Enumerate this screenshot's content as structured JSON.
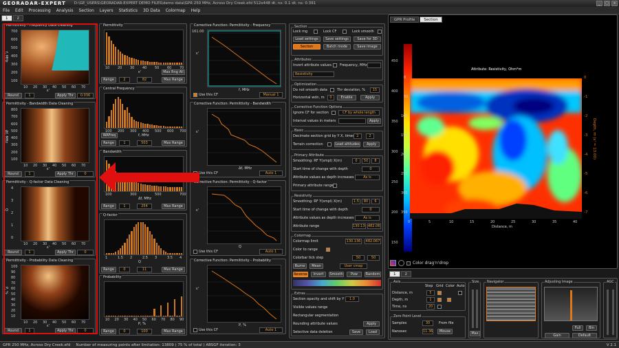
{
  "titlebar": {
    "logo": "GEORADAR-EXPERT",
    "text": "D:\\GE_USERS\\GEORADAR-EXPERT DEMO FILES\\demo data\\GPR 250 MHz, Across Dry Creek.efd    512x448    dt, ns: 0.1    dt, ns: 0.391"
  },
  "menu": [
    "File",
    "Edit",
    "Processing",
    "Analysis",
    "Section",
    "Layers",
    "Statistics",
    "3D Data",
    "Colormap",
    "Help"
  ],
  "tabs": [
    "1",
    "2"
  ],
  "left": {
    "panels": [
      {
        "title": "Permittivity - Frequency Data Cleaning",
        "ylabel": "f, MHz",
        "xlabel": "ε'",
        "yticks": [
          "700",
          "600",
          "500",
          "400",
          "300",
          "200",
          "100"
        ],
        "xticks": [
          "10",
          "20",
          "30",
          "40",
          "50",
          "60",
          "70"
        ],
        "round": "Round",
        "field1": "1",
        "applythr": "Apply Thr",
        "field2": "0.036"
      },
      {
        "title": "Permittivity - Bandwidth Data Cleaning",
        "ylabel": "Δf, MHz",
        "xlabel": "ε'",
        "yticks": [
          "800",
          "700",
          "600",
          "500",
          "400",
          "300",
          "200",
          "100"
        ],
        "xticks": [
          "10",
          "20",
          "30",
          "40",
          "50",
          "60",
          "70"
        ],
        "round": "Round",
        "field1": "1",
        "applythr": "Apply Thr",
        "field2": "0"
      },
      {
        "title": "Permittivity - Q-factor Data Cleaning",
        "ylabel": "Q",
        "xlabel": "ε'",
        "yticks": [
          "4",
          "3",
          "2",
          "1",
          "0"
        ],
        "xticks": [
          "10",
          "20",
          "30",
          "40",
          "50",
          "60",
          "70"
        ],
        "round": "Round",
        "field1": "1",
        "applythr": "Apply Thr",
        "field2": "0"
      },
      {
        "title": "Permittivity - Probability Data Cleaning",
        "ylabel": "P, %",
        "xlabel": "ε'",
        "yticks": [
          "100",
          "90",
          "80",
          "70",
          "60",
          "50",
          "40",
          "30",
          "20",
          "10"
        ],
        "xticks": [
          "10",
          "20",
          "30",
          "40",
          "50",
          "60",
          "70"
        ],
        "round": "Round",
        "field1": "1",
        "applythr": "Apply Thr",
        "field2": "0"
      }
    ]
  },
  "hist": {
    "panels": [
      {
        "title": "Permittivity",
        "xlabel": "ε'",
        "xticks": [
          "10",
          "20",
          "30",
          "40",
          "50",
          "60",
          "70"
        ],
        "range": "Range",
        "f1": "2",
        "f2": "82",
        "maxrange": "Max Rng All",
        "maxrange2": "Max Range"
      },
      {
        "title": "Central Frequency",
        "xlabel": "f, MHz",
        "xticks": [
          "100",
          "200",
          "300",
          "400",
          "500",
          "600",
          "700"
        ],
        "extra": "WAFreq",
        "range": "Range",
        "f1": "1",
        "f2": "503",
        "maxrange": "Max Range"
      },
      {
        "title": "Bandwidth",
        "xlabel": "Δf, MHz",
        "xticks": [
          "100",
          "300",
          "500",
          "700"
        ],
        "range": "Range",
        "f1": "1",
        "f2": "254",
        "maxrange": "Max Range"
      },
      {
        "title": "Q-factor",
        "xlabel": "Q",
        "xticks": [
          "1",
          "1.5",
          "2",
          "2.5",
          "3",
          "3.5",
          "4"
        ],
        "range": "Range",
        "f1": "0",
        "f2": "11",
        "maxrange": "Max Range"
      },
      {
        "title": "Probability",
        "xlabel": "P, %",
        "xticks": [
          "10",
          "20",
          "30",
          "40",
          "50",
          "60",
          "70",
          "80",
          "90"
        ],
        "range": "Range",
        "f1": "0",
        "f2": "100",
        "maxrange": "Max Range"
      }
    ]
  },
  "corr": {
    "panels": [
      {
        "title": "Corrective Function: Permittivity - Frequency",
        "xlabel": "f, MHz",
        "ylabel": "ε'",
        "useCF": "Use this CF",
        "mode": "Manual 1",
        "topval": "161.00"
      },
      {
        "title": "Corrective Function: Permittivity - Bandwidth",
        "xlabel": "Δf, MHz",
        "ylabel": "ε'",
        "useCF": "Use this CF",
        "mode": "Auto 1"
      },
      {
        "title": "Corrective Function: Permittivity - Q-factor",
        "xlabel": "Q",
        "ylabel": "ε'",
        "useCF": "Use this CF",
        "mode": "Auto 1"
      },
      {
        "title": "Corrective Function: Permittivity - Probability",
        "xlabel": "P, %",
        "ylabel": "ε'",
        "useCF": "Use this CF",
        "mode": "Auto 1"
      }
    ]
  },
  "controls": {
    "section": {
      "title": "Section",
      "lockmg": "Lock mg",
      "lockcf": "Lock CF",
      "locksmooth": "Lock smooth",
      "loadsettings": "Load settings",
      "savesettings": "Save settings",
      "save3d": "Save for 3D",
      "section": "Section",
      "batch": "Batch mode",
      "saveimage": "Save image"
    },
    "attributes": {
      "title": "Attributes",
      "invert": "Invert attribute values",
      "freq": "Frequency, MHz",
      "selected": "Resistivity"
    },
    "optimization": {
      "title": "Optimization",
      "nosmooth": "Do not smooth data",
      "thr": "Thr deviation, %",
      "thrval": "15",
      "horiz": "Horizontal wdn, m",
      "horizval": "0",
      "enable": "Enable",
      "apply": "Apply"
    },
    "cfopts": {
      "title": "Corrective Function Options",
      "ignore": "Ignore CF for section",
      "mode": "CF by whole length",
      "interval": "Interval values in meters",
      "apply": "Apply"
    },
    "basic": {
      "title": "Basic",
      "decimate": "Decimate section grid by Y X, times",
      "v1": "2",
      "v2": "2",
      "terrain": "Terrain correction",
      "loadalt": "Load altitudes",
      "apply": "Apply"
    },
    "primary": {
      "title": "Primary Attribute",
      "smoothing": "Smoothing: RF Y(smpl) X(m)",
      "s1": "0",
      "s2": "50",
      "s3": "8",
      "start": "Start time of change with depth",
      "startval": "0",
      "incr": "Attribute values as depth increases",
      "incrval": "As is",
      "range": "Primary attribute range"
    },
    "resist": {
      "title": "Resistivity",
      "smoothing": "Smoothing: RF Y(smpl) X(m)",
      "s1": "1.5",
      "s2": "80",
      "s3": "6",
      "start": "Start time of change with depth",
      "startval": "0",
      "incr": "Attribute values as depth increases",
      "incrval": "As is",
      "range": "Attribute range",
      "r1": "130.136",
      "r2": "482.067"
    },
    "colormap": {
      "title": "Colormap",
      "limit": "Colormap limit",
      "l1": "130.136",
      "l2": "482.067",
      "torange": "Color to range",
      "tickstep": "Colorbar tick step",
      "step1": "50",
      "step2": "50",
      "burne": "Burne",
      "mean": "Mean",
      "usercmap": "User cmap",
      "reverse": "Reverse",
      "invert": "Invert",
      "smooth": "Smooth",
      "pow": "Pow",
      "random": "Random"
    },
    "extras": {
      "title": "Extras",
      "opacity": "Section opacity and shift by Y",
      "opval": "1.0",
      "visible": "Visible values range",
      "rect": "Rectangular segmentation",
      "rounding": "Rounding attribute values",
      "selective": "Selective data deletion",
      "apply": "Apply",
      "save": "Save",
      "load": "Load"
    }
  },
  "right": {
    "tabs": [
      "GPR Profile",
      "Section"
    ],
    "chartTitle": "Attribute: Resistivity, Ohm*m",
    "xlabel": "Distance, m",
    "ylabelR": "Depth, m (ε' = 13.00)",
    "cbticks": [
      "450",
      "400",
      "350",
      "300",
      "250",
      "200",
      "150"
    ],
    "yticksL": [
      "0",
      "50",
      "100",
      "150",
      "200",
      "250",
      "300",
      "350"
    ],
    "yticksR": [
      "0",
      "-1",
      "-2",
      "-3",
      "-4",
      "-5",
      "-6",
      "-7"
    ],
    "xticks": [
      "0",
      "5",
      "10",
      "15",
      "20",
      "25",
      "30",
      "35",
      "40"
    ],
    "colordrag": "Color drag'n'drop",
    "bottomTabs": [
      "1",
      "2"
    ]
  },
  "bottom": {
    "axis": {
      "title": "Axis",
      "distance": "Distance, m",
      "depth": "Depth, m",
      "time": "Time, ns",
      "step": "Step",
      "grid": "Grid",
      "color": "Color",
      "auto": "Auto",
      "v1": "5",
      "v2": "1",
      "v3": "20"
    },
    "zero": {
      "title": "Zero Point Level",
      "samples": "Samples",
      "sval": "30",
      "fromfile": "From file",
      "nanosec": "Nanosec",
      "nval": "11.36",
      "mouse": "Mouse"
    },
    "size": {
      "title": "Size",
      "x": "X",
      "y": "Y",
      "max": "Max"
    },
    "navigator": {
      "title": "Navigator"
    },
    "adjusting": {
      "title": "Adjusting Image",
      "full": "Full",
      "bin": "Bin",
      "gain": "Gain",
      "default": "Default"
    },
    "agc": {
      "title": "AGC",
      "w": "W",
      "l": "L"
    }
  },
  "status": {
    "file": "GPR 250 MHz, Across Dry Creek.efd",
    "points": "Number of measuring points after limitation: 13809  ( 75 % of total )  ABSGF iteration: 3",
    "version": "V 2.1"
  }
}
